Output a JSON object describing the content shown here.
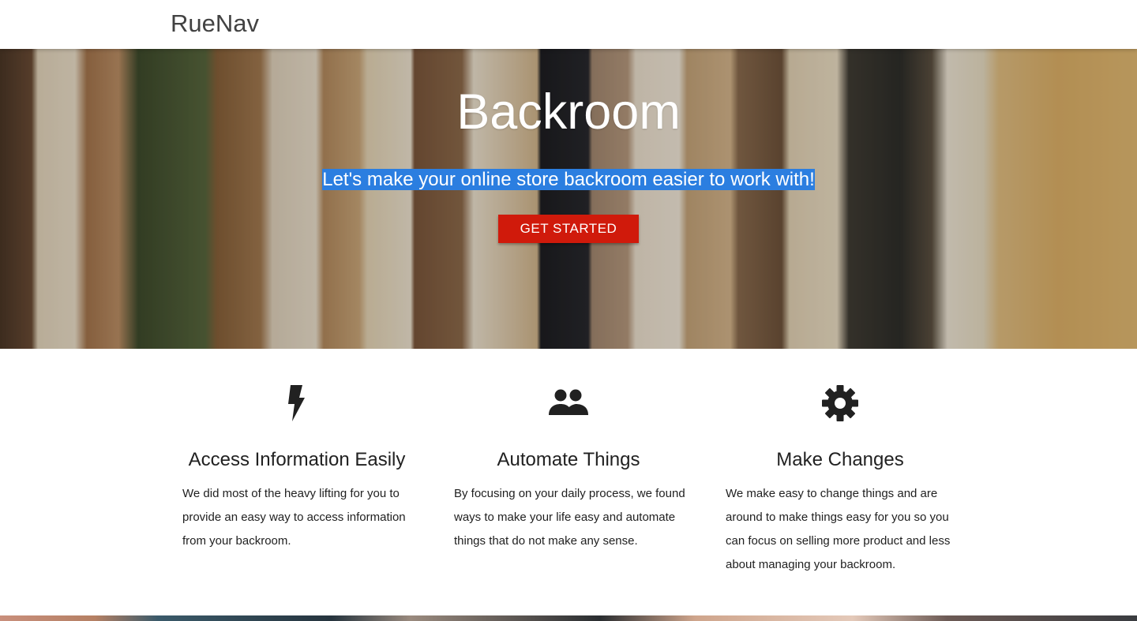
{
  "nav": {
    "brand": "RueNav"
  },
  "hero": {
    "title": "Backroom",
    "subtitle": "Let's make your online store backroom easier to work with!",
    "cta_label": "GET STARTED",
    "cta_color": "#d01a0b",
    "selection_color": "#2b7ee0"
  },
  "features": [
    {
      "icon": "bolt-icon",
      "title": "Access Information Easily",
      "text": "We did most of the heavy lifting for you to provide an easy way to access information from your backroom."
    },
    {
      "icon": "people-icon",
      "title": "Automate Things",
      "text": "By focusing on your daily process, we found ways to make your life easy and automate things that do not make any sense."
    },
    {
      "icon": "gear-icon",
      "title": "Make Changes",
      "text": "We make easy to change things and are around to make things easy for you so you can focus on selling more product and less about managing your backroom."
    }
  ]
}
